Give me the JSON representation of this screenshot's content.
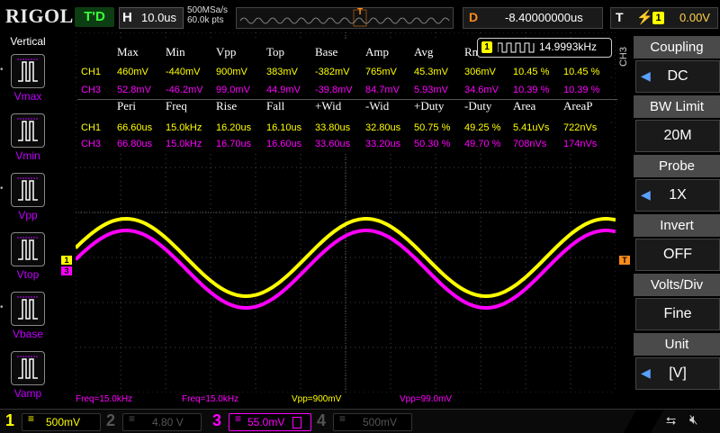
{
  "topbar": {
    "logo": "RIGOL",
    "trigger_status": "T'D",
    "horizontal_label": "H",
    "timebase": "10.0us",
    "sample_rate": "500MSa/s",
    "memory_depth": "60.0k pts",
    "trigger_position_marker": "T",
    "delay_label": "D",
    "delay_value": "-8.40000000us",
    "trigger_label": "T",
    "trigger_source": "1",
    "trigger_level": "0.00V"
  },
  "left_panel": {
    "title": "Vertical",
    "items": [
      {
        "label": "Vmax",
        "icon": "vmax-icon"
      },
      {
        "label": "Vmin",
        "icon": "vmin-icon"
      },
      {
        "label": "Vpp",
        "icon": "vpp-icon"
      },
      {
        "label": "Vtop",
        "icon": "vtop-icon"
      },
      {
        "label": "Vbase",
        "icon": "vbase-icon"
      },
      {
        "label": "Vamp",
        "icon": "vamp-icon"
      }
    ]
  },
  "measure_table": {
    "header1": [
      "Max",
      "Min",
      "Vpp",
      "Top",
      "Base",
      "Amp",
      "Avg",
      "Rms",
      "",
      ""
    ],
    "row1": {
      "ch": "CH1",
      "values": [
        "460mV",
        "-440mV",
        "900mV",
        "383mV",
        "-382mV",
        "765mV",
        "45.3mV",
        "306mV",
        "10.45 %",
        "10.45 %"
      ]
    },
    "row2": {
      "ch": "CH3",
      "values": [
        "52.8mV",
        "-46.2mV",
        "99.0mV",
        "44.9mV",
        "-39.8mV",
        "84.7mV",
        "5.93mV",
        "34.6mV",
        "10.39 %",
        "10.39 %"
      ]
    },
    "header2": [
      "Peri",
      "Freq",
      "Rise",
      "Fall",
      "+Wid",
      "-Wid",
      "+Duty",
      "-Duty",
      "Area",
      "AreaP"
    ],
    "row3": {
      "ch": "CH1",
      "values": [
        "66.60us",
        "15.0kHz",
        "16.20us",
        "16.10us",
        "33.80us",
        "32.80us",
        "50.75 %",
        "49.25 %",
        "5.41uVs",
        "722nVs"
      ]
    },
    "row4": {
      "ch": "CH3",
      "values": [
        "66.80us",
        "15.0kHz",
        "16.70us",
        "16.60us",
        "33.60us",
        "33.20us",
        "50.30 %",
        "49.70 %",
        "708nVs",
        "174nVs"
      ]
    }
  },
  "frequency_counter": {
    "channel": "1",
    "value": "14.9993kHz"
  },
  "side_channel_label": "CH3",
  "screen_markers": {
    "ch1": "1",
    "ch3": "3",
    "trigger": "T"
  },
  "bottom_stats": [
    {
      "text": "Freq=15.0kHz",
      "color": "#ff00ff"
    },
    {
      "text": "Freq=15.0kHz",
      "color": "#ff00ff"
    },
    {
      "text": "Vpp=900mV",
      "color": "#ffff00"
    },
    {
      "text": "Vpp=99.0mV",
      "color": "#ff00ff"
    }
  ],
  "right_panel": [
    {
      "title": "Coupling",
      "value": "DC"
    },
    {
      "title": "BW Limit",
      "value": "20M"
    },
    {
      "title": "Probe",
      "value": "1X"
    },
    {
      "title": "Invert",
      "value": "OFF"
    },
    {
      "title": "Volts/Div",
      "value": "Fine"
    },
    {
      "title": "Unit",
      "value": "[V]"
    }
  ],
  "bottom_bar": {
    "ch1": {
      "num": "1",
      "scale": "500mV",
      "color": "#ffff00"
    },
    "ch2": {
      "num": "2",
      "scale": "4.80 V",
      "color": "#555555"
    },
    "ch3": {
      "num": "3",
      "scale": "55.0mV",
      "color": "#ff00ff"
    },
    "ch4": {
      "num": "4",
      "scale": "500mV",
      "color": "#555555"
    }
  },
  "colors": {
    "ch1": "#ffff00",
    "ch3": "#ff00ff",
    "trigger": "#ff8c1a",
    "menu_accent": "#5aa0ff"
  }
}
